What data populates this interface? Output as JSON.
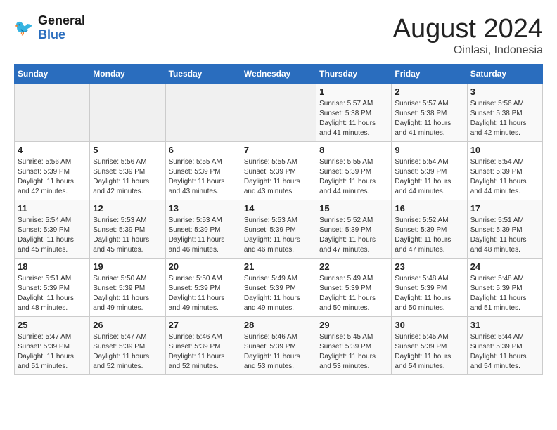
{
  "header": {
    "logo_line1": "General",
    "logo_line2": "Blue",
    "title": "August 2024",
    "subtitle": "Oinlasi, Indonesia"
  },
  "weekdays": [
    "Sunday",
    "Monday",
    "Tuesday",
    "Wednesday",
    "Thursday",
    "Friday",
    "Saturday"
  ],
  "weeks": [
    [
      {
        "day": "",
        "sunrise": "",
        "sunset": "",
        "daylight": ""
      },
      {
        "day": "",
        "sunrise": "",
        "sunset": "",
        "daylight": ""
      },
      {
        "day": "",
        "sunrise": "",
        "sunset": "",
        "daylight": ""
      },
      {
        "day": "",
        "sunrise": "",
        "sunset": "",
        "daylight": ""
      },
      {
        "day": "1",
        "sunrise": "Sunrise: 5:57 AM",
        "sunset": "Sunset: 5:38 PM",
        "daylight": "Daylight: 11 hours and 41 minutes."
      },
      {
        "day": "2",
        "sunrise": "Sunrise: 5:57 AM",
        "sunset": "Sunset: 5:38 PM",
        "daylight": "Daylight: 11 hours and 41 minutes."
      },
      {
        "day": "3",
        "sunrise": "Sunrise: 5:56 AM",
        "sunset": "Sunset: 5:38 PM",
        "daylight": "Daylight: 11 hours and 42 minutes."
      }
    ],
    [
      {
        "day": "4",
        "sunrise": "Sunrise: 5:56 AM",
        "sunset": "Sunset: 5:39 PM",
        "daylight": "Daylight: 11 hours and 42 minutes."
      },
      {
        "day": "5",
        "sunrise": "Sunrise: 5:56 AM",
        "sunset": "Sunset: 5:39 PM",
        "daylight": "Daylight: 11 hours and 42 minutes."
      },
      {
        "day": "6",
        "sunrise": "Sunrise: 5:55 AM",
        "sunset": "Sunset: 5:39 PM",
        "daylight": "Daylight: 11 hours and 43 minutes."
      },
      {
        "day": "7",
        "sunrise": "Sunrise: 5:55 AM",
        "sunset": "Sunset: 5:39 PM",
        "daylight": "Daylight: 11 hours and 43 minutes."
      },
      {
        "day": "8",
        "sunrise": "Sunrise: 5:55 AM",
        "sunset": "Sunset: 5:39 PM",
        "daylight": "Daylight: 11 hours and 44 minutes."
      },
      {
        "day": "9",
        "sunrise": "Sunrise: 5:54 AM",
        "sunset": "Sunset: 5:39 PM",
        "daylight": "Daylight: 11 hours and 44 minutes."
      },
      {
        "day": "10",
        "sunrise": "Sunrise: 5:54 AM",
        "sunset": "Sunset: 5:39 PM",
        "daylight": "Daylight: 11 hours and 44 minutes."
      }
    ],
    [
      {
        "day": "11",
        "sunrise": "Sunrise: 5:54 AM",
        "sunset": "Sunset: 5:39 PM",
        "daylight": "Daylight: 11 hours and 45 minutes."
      },
      {
        "day": "12",
        "sunrise": "Sunrise: 5:53 AM",
        "sunset": "Sunset: 5:39 PM",
        "daylight": "Daylight: 11 hours and 45 minutes."
      },
      {
        "day": "13",
        "sunrise": "Sunrise: 5:53 AM",
        "sunset": "Sunset: 5:39 PM",
        "daylight": "Daylight: 11 hours and 46 minutes."
      },
      {
        "day": "14",
        "sunrise": "Sunrise: 5:53 AM",
        "sunset": "Sunset: 5:39 PM",
        "daylight": "Daylight: 11 hours and 46 minutes."
      },
      {
        "day": "15",
        "sunrise": "Sunrise: 5:52 AM",
        "sunset": "Sunset: 5:39 PM",
        "daylight": "Daylight: 11 hours and 47 minutes."
      },
      {
        "day": "16",
        "sunrise": "Sunrise: 5:52 AM",
        "sunset": "Sunset: 5:39 PM",
        "daylight": "Daylight: 11 hours and 47 minutes."
      },
      {
        "day": "17",
        "sunrise": "Sunrise: 5:51 AM",
        "sunset": "Sunset: 5:39 PM",
        "daylight": "Daylight: 11 hours and 48 minutes."
      }
    ],
    [
      {
        "day": "18",
        "sunrise": "Sunrise: 5:51 AM",
        "sunset": "Sunset: 5:39 PM",
        "daylight": "Daylight: 11 hours and 48 minutes."
      },
      {
        "day": "19",
        "sunrise": "Sunrise: 5:50 AM",
        "sunset": "Sunset: 5:39 PM",
        "daylight": "Daylight: 11 hours and 49 minutes."
      },
      {
        "day": "20",
        "sunrise": "Sunrise: 5:50 AM",
        "sunset": "Sunset: 5:39 PM",
        "daylight": "Daylight: 11 hours and 49 minutes."
      },
      {
        "day": "21",
        "sunrise": "Sunrise: 5:49 AM",
        "sunset": "Sunset: 5:39 PM",
        "daylight": "Daylight: 11 hours and 49 minutes."
      },
      {
        "day": "22",
        "sunrise": "Sunrise: 5:49 AM",
        "sunset": "Sunset: 5:39 PM",
        "daylight": "Daylight: 11 hours and 50 minutes."
      },
      {
        "day": "23",
        "sunrise": "Sunrise: 5:48 AM",
        "sunset": "Sunset: 5:39 PM",
        "daylight": "Daylight: 11 hours and 50 minutes."
      },
      {
        "day": "24",
        "sunrise": "Sunrise: 5:48 AM",
        "sunset": "Sunset: 5:39 PM",
        "daylight": "Daylight: 11 hours and 51 minutes."
      }
    ],
    [
      {
        "day": "25",
        "sunrise": "Sunrise: 5:47 AM",
        "sunset": "Sunset: 5:39 PM",
        "daylight": "Daylight: 11 hours and 51 minutes."
      },
      {
        "day": "26",
        "sunrise": "Sunrise: 5:47 AM",
        "sunset": "Sunset: 5:39 PM",
        "daylight": "Daylight: 11 hours and 52 minutes."
      },
      {
        "day": "27",
        "sunrise": "Sunrise: 5:46 AM",
        "sunset": "Sunset: 5:39 PM",
        "daylight": "Daylight: 11 hours and 52 minutes."
      },
      {
        "day": "28",
        "sunrise": "Sunrise: 5:46 AM",
        "sunset": "Sunset: 5:39 PM",
        "daylight": "Daylight: 11 hours and 53 minutes."
      },
      {
        "day": "29",
        "sunrise": "Sunrise: 5:45 AM",
        "sunset": "Sunset: 5:39 PM",
        "daylight": "Daylight: 11 hours and 53 minutes."
      },
      {
        "day": "30",
        "sunrise": "Sunrise: 5:45 AM",
        "sunset": "Sunset: 5:39 PM",
        "daylight": "Daylight: 11 hours and 54 minutes."
      },
      {
        "day": "31",
        "sunrise": "Sunrise: 5:44 AM",
        "sunset": "Sunset: 5:39 PM",
        "daylight": "Daylight: 11 hours and 54 minutes."
      }
    ]
  ]
}
